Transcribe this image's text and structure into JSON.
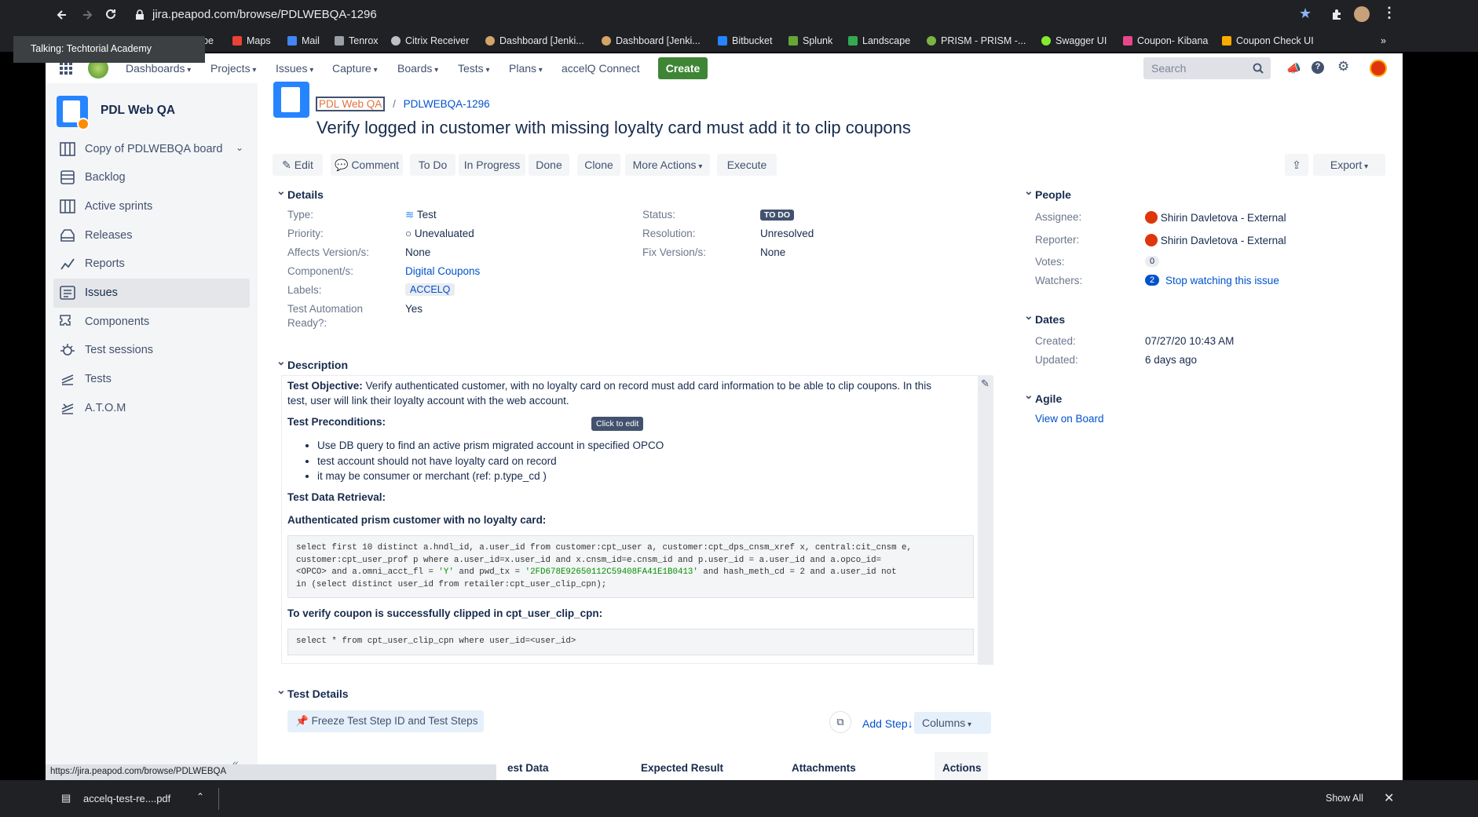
{
  "browser": {
    "url": "jira.peapod.com/browse/PDLWEBQA-1296",
    "bookmarks": [
      "be",
      "Maps",
      "Mail",
      "Tenrox",
      "Citrix Receiver",
      "Dashboard [Jenki...",
      "Dashboard [Jenki...",
      "Bitbucket",
      "Splunk",
      "Landscape",
      "PRISM - PRISM -...",
      "Swagger UI",
      "Coupon- Kibana",
      "Coupon Check UI"
    ],
    "bookmarks_more": "»",
    "toast": "Talking: Techtorial Academy",
    "status_url": "https://jira.peapod.com/browse/PDLWEBQA",
    "download_file": "accelq-test-re....pdf",
    "show_all": "Show All"
  },
  "header": {
    "nav": [
      "Dashboards",
      "Projects",
      "Issues",
      "Capture",
      "Boards",
      "Tests",
      "Plans",
      "accelQ Connect"
    ],
    "create": "Create",
    "search_placeholder": "Search"
  },
  "sidebar": {
    "project_name": "PDL Web QA",
    "board": "Copy of PDLWEBQA board",
    "items": [
      {
        "label": "Backlog",
        "icon": "backlog-icon"
      },
      {
        "label": "Active sprints",
        "icon": "sprints-icon"
      },
      {
        "label": "Releases",
        "icon": "releases-icon"
      },
      {
        "label": "Reports",
        "icon": "reports-icon"
      },
      {
        "label": "Issues",
        "icon": "issues-icon"
      },
      {
        "label": "Components",
        "icon": "components-icon"
      },
      {
        "label": "Test sessions",
        "icon": "test-sessions-icon"
      },
      {
        "label": "Tests",
        "icon": "tests-icon"
      },
      {
        "label": "A.T.O.M",
        "icon": "atom-icon"
      }
    ]
  },
  "issue": {
    "breadcrumb_project": "PDL Web QA",
    "breadcrumb_sep": "/",
    "key": "PDLWEBQA-1296",
    "title": "Verify logged in customer with missing loyalty card must add it to clip coupons",
    "actions": {
      "edit": "Edit",
      "comment": "Comment",
      "todo": "To Do",
      "in_progress": "In Progress",
      "done": "Done",
      "clone": "Clone",
      "more": "More Actions",
      "execute": "Execute",
      "export": "Export"
    }
  },
  "details": {
    "heading": "Details",
    "type_label": "Type:",
    "type_value": "Test",
    "priority_label": "Priority:",
    "priority_value": "Unevaluated",
    "affects_label": "Affects Version/s:",
    "affects_value": "None",
    "component_label": "Component/s:",
    "component_value": "Digital Coupons",
    "labels_label": "Labels:",
    "labels_value": "ACCELQ",
    "automation_label_1": "Test Automation",
    "automation_label_2": "Ready?:",
    "automation_value": "Yes",
    "status_label": "Status:",
    "status_value": "TO DO",
    "resolution_label": "Resolution:",
    "resolution_value": "Unresolved",
    "fix_label": "Fix Version/s:",
    "fix_value": "None"
  },
  "people": {
    "heading": "People",
    "assignee_label": "Assignee:",
    "assignee_value": "Shirin Davletova - External",
    "reporter_label": "Reporter:",
    "reporter_value": "Shirin Davletova - External",
    "votes_label": "Votes:",
    "votes_value": "0",
    "watchers_label": "Watchers:",
    "watchers_count": "2",
    "watchers_link": "Stop watching this issue"
  },
  "dates": {
    "heading": "Dates",
    "created_label": "Created:",
    "created_value": "07/27/20 10:43 AM",
    "updated_label": "Updated:",
    "updated_value": "6 days ago"
  },
  "agile": {
    "heading": "Agile",
    "link": "View on Board"
  },
  "description": {
    "heading": "Description",
    "objective_label": "Test Objective:",
    "objective_line1": "Verify authenticated customer, with no loyalty card on record must add card information  to be able to clip coupons. In this",
    "objective_line2": "test, user will link their loyalty account with the web account.",
    "tooltip": "Click to edit",
    "preconditions_heading": "Test Preconditions:",
    "preconditions": [
      "Use DB query to find an active prism migrated account in specified OPCO",
      "test account should not have loyalty card on record",
      "it may be consumer or merchant (ref: p.type_cd )"
    ],
    "retrieval_heading": "Test Data Retrieval:",
    "retrieval_sub": "Authenticated prism customer with no loyalty card:",
    "sql1_line1": "select first 10 distinct a.hndl_id, a.user_id from customer:cpt_user a, customer:cpt_dps_cnsm_xref x, central:cit_cnsm e,",
    "sql1_line2": "customer:cpt_user_prof p where a.user_id=x.user_id and x.cnsm_id=e.cnsm_id and p.user_id = a.user_id and a.opco_id=",
    "sql1_line3a": "<OPCO> and a.omni_acct_fl = ",
    "sql1_line3b": "'Y'",
    "sql1_line3c": " and pwd_tx = ",
    "sql1_line3d": "'2FD678E92650112C59408FA41E1B0413'",
    "sql1_line3e": " and hash_meth_cd = 2  and a.user_id not",
    "sql1_line4": "in (select distinct user_id from retailer:cpt_user_clip_cpn);",
    "verify_heading": "To verify coupon is successfully clipped in cpt_user_clip_cpn:",
    "sql2": "select * from cpt_user_clip_cpn where user_id=<user_id>"
  },
  "test_details": {
    "heading": "Test Details",
    "freeze_button": "Freeze Test Step ID and Test Steps",
    "add_step": "Add Step↓",
    "columns": "Columns",
    "col_test_data": "est Data",
    "col_expected": "Expected Result",
    "col_attachments": "Attachments",
    "col_actions": "Actions"
  },
  "colors": {
    "accent": "#0052cc",
    "create": "#3e8635",
    "sidebar": "#f4f5f7",
    "browser": "#202124"
  }
}
